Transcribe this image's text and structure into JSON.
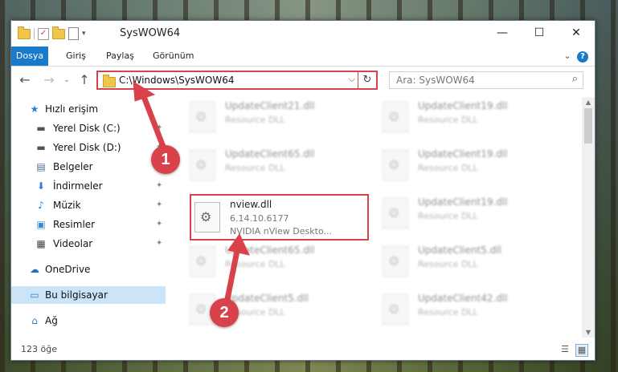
{
  "window": {
    "title": "SysWOW64",
    "minimize_glyph": "—",
    "maximize_glyph": "☐",
    "close_glyph": "✕"
  },
  "ribbon": {
    "tabs": [
      {
        "label": "Dosya"
      },
      {
        "label": "Giriş"
      },
      {
        "label": "Paylaş"
      },
      {
        "label": "Görünüm"
      }
    ],
    "help_glyph": "?"
  },
  "address": {
    "path": "C:\\Windows\\SysWOW64",
    "refresh_glyph": "↻",
    "dropdown_glyph": "⌵"
  },
  "search": {
    "placeholder": "Ara: SysWOW64",
    "icon": "search-icon"
  },
  "nav": {
    "back_glyph": "←",
    "forward_glyph": "→",
    "up_glyph": "↑",
    "items": [
      {
        "label": "Hızlı erişim",
        "icon": "star-icon",
        "glyph": "★"
      },
      {
        "label": "Yerel Disk (C:)",
        "icon": "drive-icon",
        "glyph": "▬"
      },
      {
        "label": "Yerel Disk (D:)",
        "icon": "drive-icon",
        "glyph": "▬"
      },
      {
        "label": "Belgeler",
        "icon": "document-icon",
        "glyph": "▤"
      },
      {
        "label": "İndirmeler",
        "icon": "download-icon",
        "glyph": "⬇"
      },
      {
        "label": "Müzik",
        "icon": "music-icon",
        "glyph": "♪"
      },
      {
        "label": "Resimler",
        "icon": "picture-icon",
        "glyph": "▣"
      },
      {
        "label": "Videolar",
        "icon": "video-icon",
        "glyph": "▦"
      },
      {
        "label": "OneDrive",
        "icon": "cloud-icon",
        "glyph": "☁"
      },
      {
        "label": "Bu bilgisayar",
        "icon": "computer-icon",
        "glyph": "▭"
      },
      {
        "label": "Ağ",
        "icon": "network-icon",
        "glyph": "⌂"
      }
    ],
    "pin_glyph": "📌"
  },
  "files": {
    "left_column": [
      {
        "name": "UpdateClient21.dll",
        "desc": "Resource DLL"
      },
      {
        "name": "UpdateClient65.dll",
        "desc": "Resource DLL"
      },
      {
        "name": "UpdateClient65.dll",
        "desc": "Resource DLL"
      },
      {
        "name": "UpdateClient5.dll",
        "desc": "Resource DLL"
      }
    ],
    "right_column": [
      {
        "name": "UpdateClient19.dll",
        "desc": "Resource DLL"
      },
      {
        "name": "UpdateClient19.dll",
        "desc": "Resource DLL"
      },
      {
        "name": "UpdateClient19.dll",
        "desc": "Resource DLL"
      },
      {
        "name": "UpdateClient5.dll",
        "desc": "Resource DLL"
      },
      {
        "name": "UpdateClient42.dll",
        "desc": "Resource DLL"
      }
    ],
    "highlighted": {
      "name": "nview.dll",
      "version": "6.14.10.6177",
      "description": "NVIDIA nView Deskto..."
    }
  },
  "status": {
    "count_text": "123 öğe"
  },
  "annotations": {
    "step1": "1",
    "step2": "2",
    "color": "#d9424a"
  }
}
